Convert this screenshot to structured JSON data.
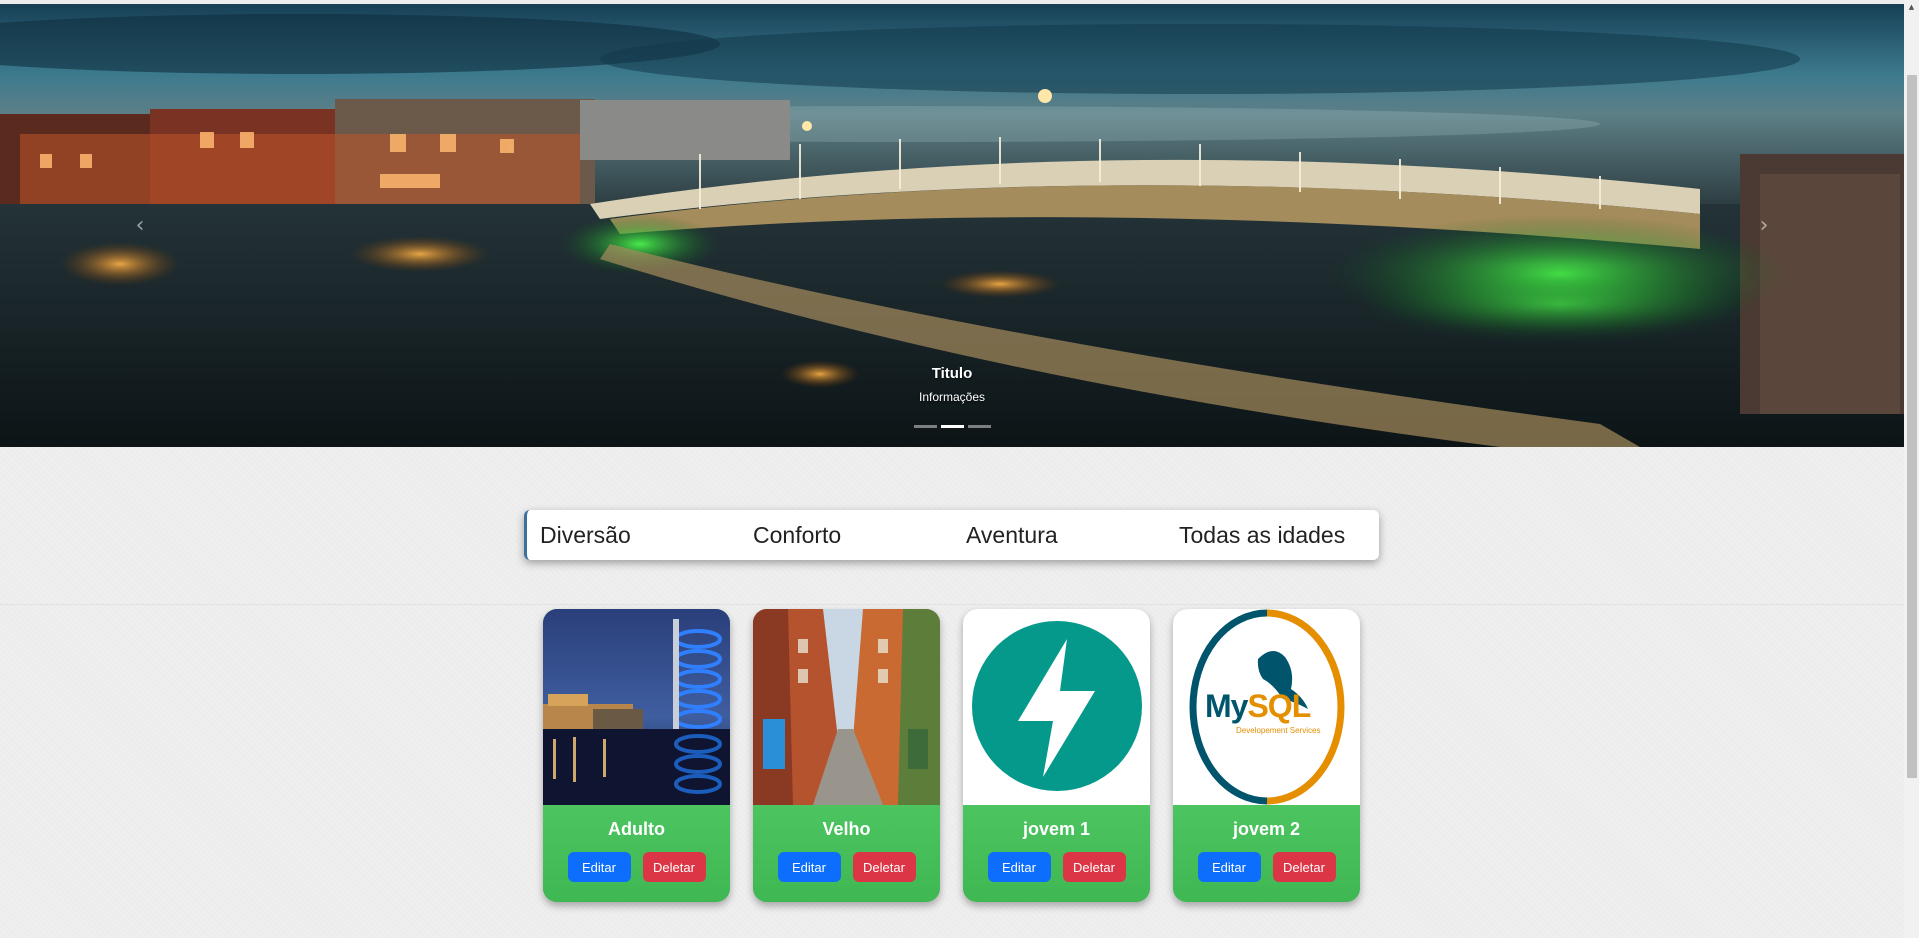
{
  "carousel": {
    "caption_title": "Titulo",
    "caption_text": "Informações",
    "prev_icon": "chevron-left-icon",
    "next_icon": "chevron-right-icon",
    "slide_count": 3,
    "active_slide": 2
  },
  "categories": [
    "Diversão",
    "Conforto",
    "Aventura",
    "Todas as idades"
  ],
  "cards": [
    {
      "title": "Adulto",
      "edit_label": "Editar",
      "delete_label": "Deletar",
      "image": "city-night-photo"
    },
    {
      "title": "Velho",
      "edit_label": "Editar",
      "delete_label": "Deletar",
      "image": "street-photo"
    },
    {
      "title": "jovem 1",
      "edit_label": "Editar",
      "delete_label": "Deletar",
      "image": "lightning-logo"
    },
    {
      "title": "jovem 2",
      "edit_label": "Editar",
      "delete_label": "Deletar",
      "image": "mysql-logo",
      "logo_text": "MySQL",
      "logo_subtext": "Developement Services"
    }
  ],
  "colors": {
    "card_green": "#46bd5c",
    "edit_blue": "#0d6efd",
    "delete_red": "#dc3545",
    "fastapi_teal": "#05998b",
    "mysql_blue": "#00546b",
    "mysql_orange": "#e48e00"
  }
}
